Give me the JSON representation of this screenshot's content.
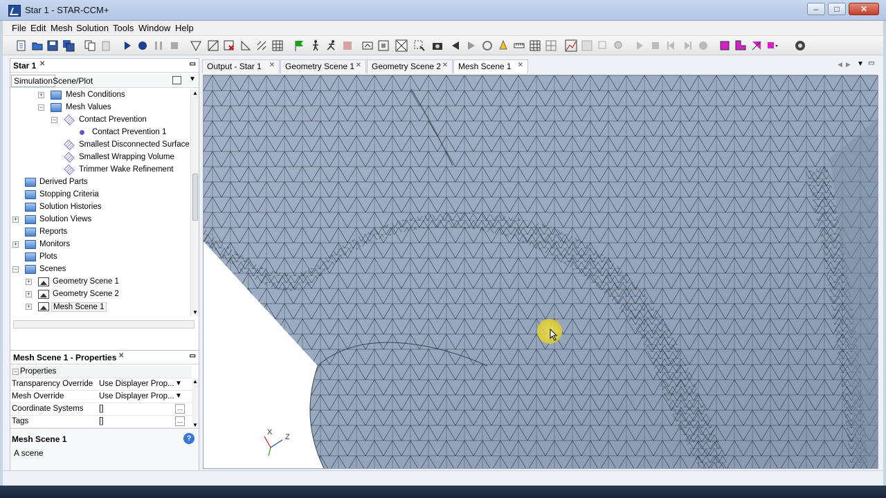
{
  "window": {
    "title": "Star 1 - STAR-CCM+"
  },
  "menu": [
    "File",
    "Edit",
    "Mesh",
    "Solution",
    "Tools",
    "Window",
    "Help"
  ],
  "tree_panel": {
    "title": "Star 1",
    "tabs": [
      "Simulation",
      "Scene/Plot"
    ],
    "items": [
      {
        "label": "Mesh Conditions",
        "icon": "folder-icon"
      },
      {
        "label": "Mesh Values",
        "icon": "folder-icon"
      },
      {
        "label": "Contact Prevention",
        "icon": "mesh-icon"
      },
      {
        "label": "Contact Prevention 1",
        "icon": "dot-icon"
      },
      {
        "label": "Smallest Disconnected Surface",
        "icon": "mesh-icon"
      },
      {
        "label": "Smallest Wrapping Volume",
        "icon": "mesh-icon"
      },
      {
        "label": "Trimmer Wake Refinement",
        "icon": "mesh-icon"
      },
      {
        "label": "Derived Parts",
        "icon": "folder-icon"
      },
      {
        "label": "Stopping Criteria",
        "icon": "folder-icon"
      },
      {
        "label": "Solution Histories",
        "icon": "folder-icon"
      },
      {
        "label": "Solution Views",
        "icon": "folder-icon"
      },
      {
        "label": "Reports",
        "icon": "folder-icon"
      },
      {
        "label": "Monitors",
        "icon": "folder-icon"
      },
      {
        "label": "Plots",
        "icon": "folder-icon"
      },
      {
        "label": "Scenes",
        "icon": "folder-icon"
      },
      {
        "label": "Geometry Scene 1",
        "icon": "scene-icon"
      },
      {
        "label": "Geometry Scene 2",
        "icon": "scene-icon"
      },
      {
        "label": "Mesh Scene 1",
        "icon": "scene-icon"
      }
    ]
  },
  "properties_panel": {
    "title": "Mesh Scene 1 - Properties",
    "section": "Properties",
    "rows": [
      {
        "key": "Transparency Override",
        "value": "Use Displayer Prop..."
      },
      {
        "key": "Mesh Override",
        "value": "Use Displayer Prop..."
      },
      {
        "key": "Coordinate Systems",
        "value": "[]"
      },
      {
        "key": "Tags",
        "value": "[]"
      }
    ],
    "description_title": "Mesh Scene 1",
    "description_text": "A scene"
  },
  "editor_tabs": [
    "Output - Star 1",
    "Geometry Scene 1",
    "Geometry Scene 2",
    "Mesh Scene 1"
  ],
  "active_tab": "Mesh Scene 1",
  "axes": {
    "x": "X",
    "z": "Z"
  }
}
